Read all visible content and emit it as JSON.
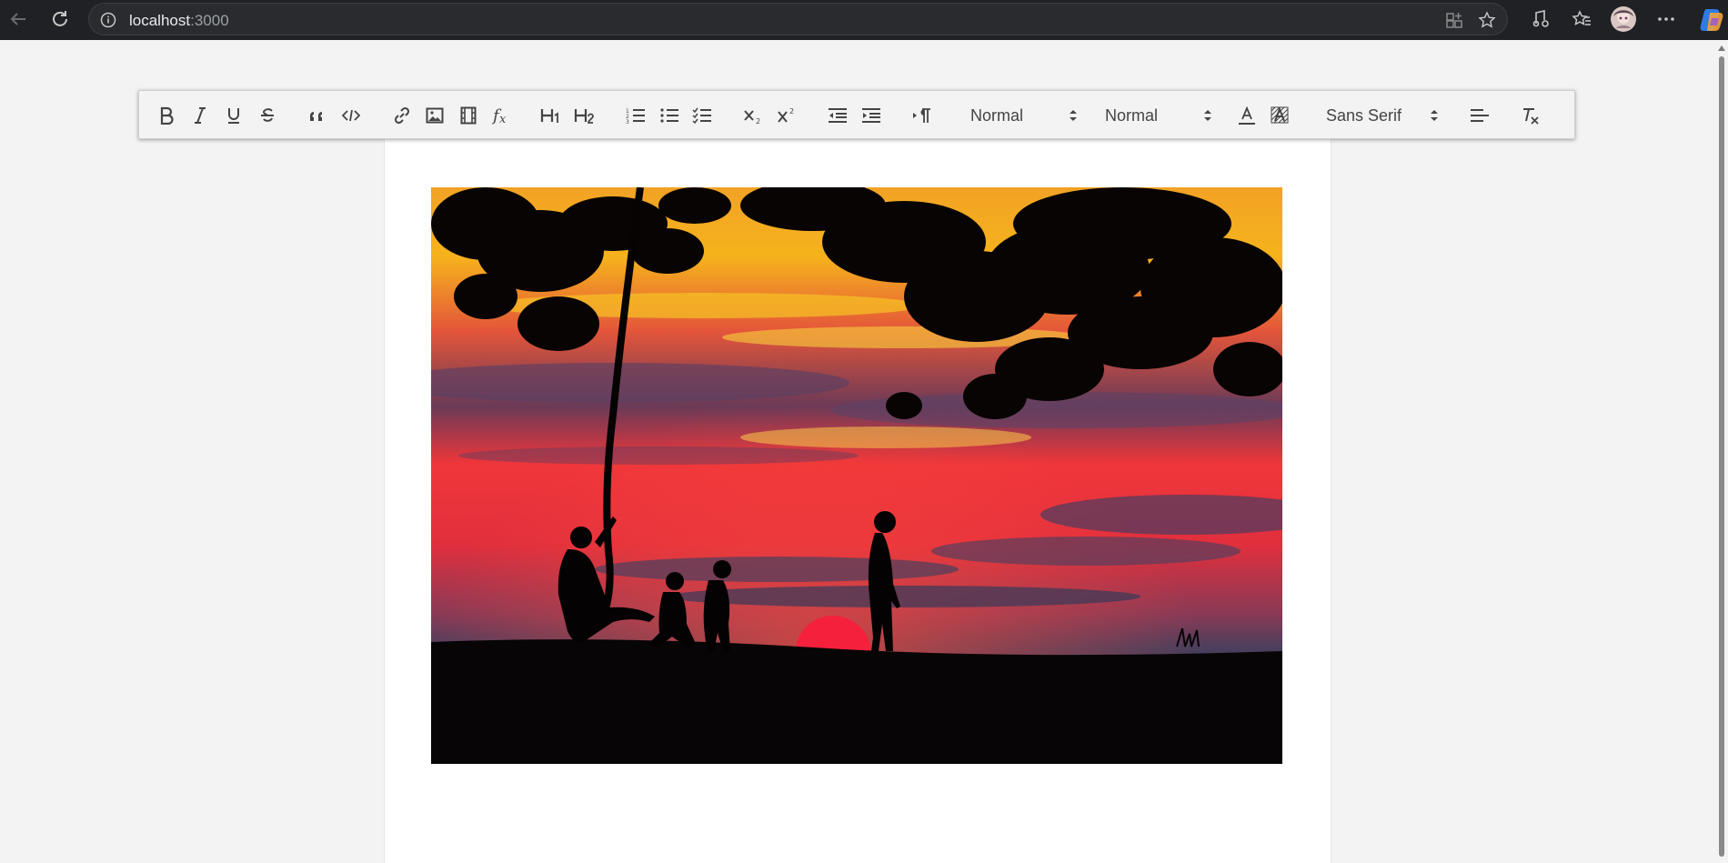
{
  "browser": {
    "url_host": "localhost",
    "url_port": ":3000"
  },
  "toolbar": {
    "header_picker": "Normal",
    "size_picker": "Normal",
    "font_picker": "Sans Serif"
  },
  "colors": {
    "chrome_bg": "#202124",
    "page_bg": "#f3f3f3",
    "paper_bg": "#ffffff",
    "toolbar_icon": "#444444"
  },
  "image": {
    "alt": "sunset silhouette"
  }
}
